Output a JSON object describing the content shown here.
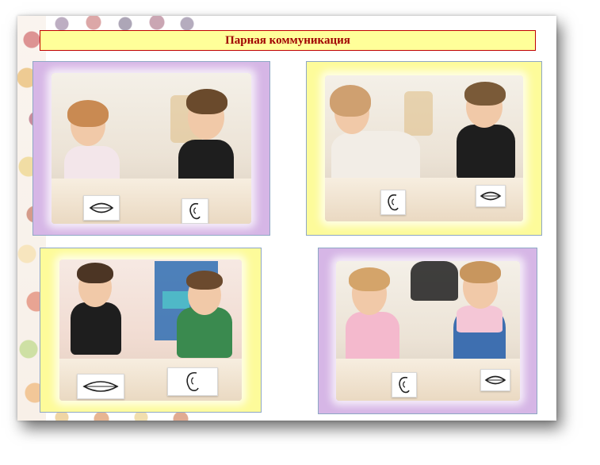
{
  "slide": {
    "title": "Парная коммуникация"
  },
  "colors": {
    "title_background": "#ffff99",
    "title_border": "#c00000",
    "title_text": "#a00000",
    "frame_purple": "#d6b6e6",
    "frame_yellow": "#fdfb9a"
  },
  "photos": [
    {
      "frame": "purple",
      "icons": [
        "lips-card-icon",
        "ear-card-icon"
      ]
    },
    {
      "frame": "yellow",
      "icons": [
        "ear-card-icon",
        "lips-card-icon"
      ]
    },
    {
      "frame": "yellow",
      "icons": [
        "lips-card-icon",
        "ear-card-icon"
      ]
    },
    {
      "frame": "purple",
      "icons": [
        "ear-card-icon",
        "lips-card-icon"
      ]
    }
  ]
}
